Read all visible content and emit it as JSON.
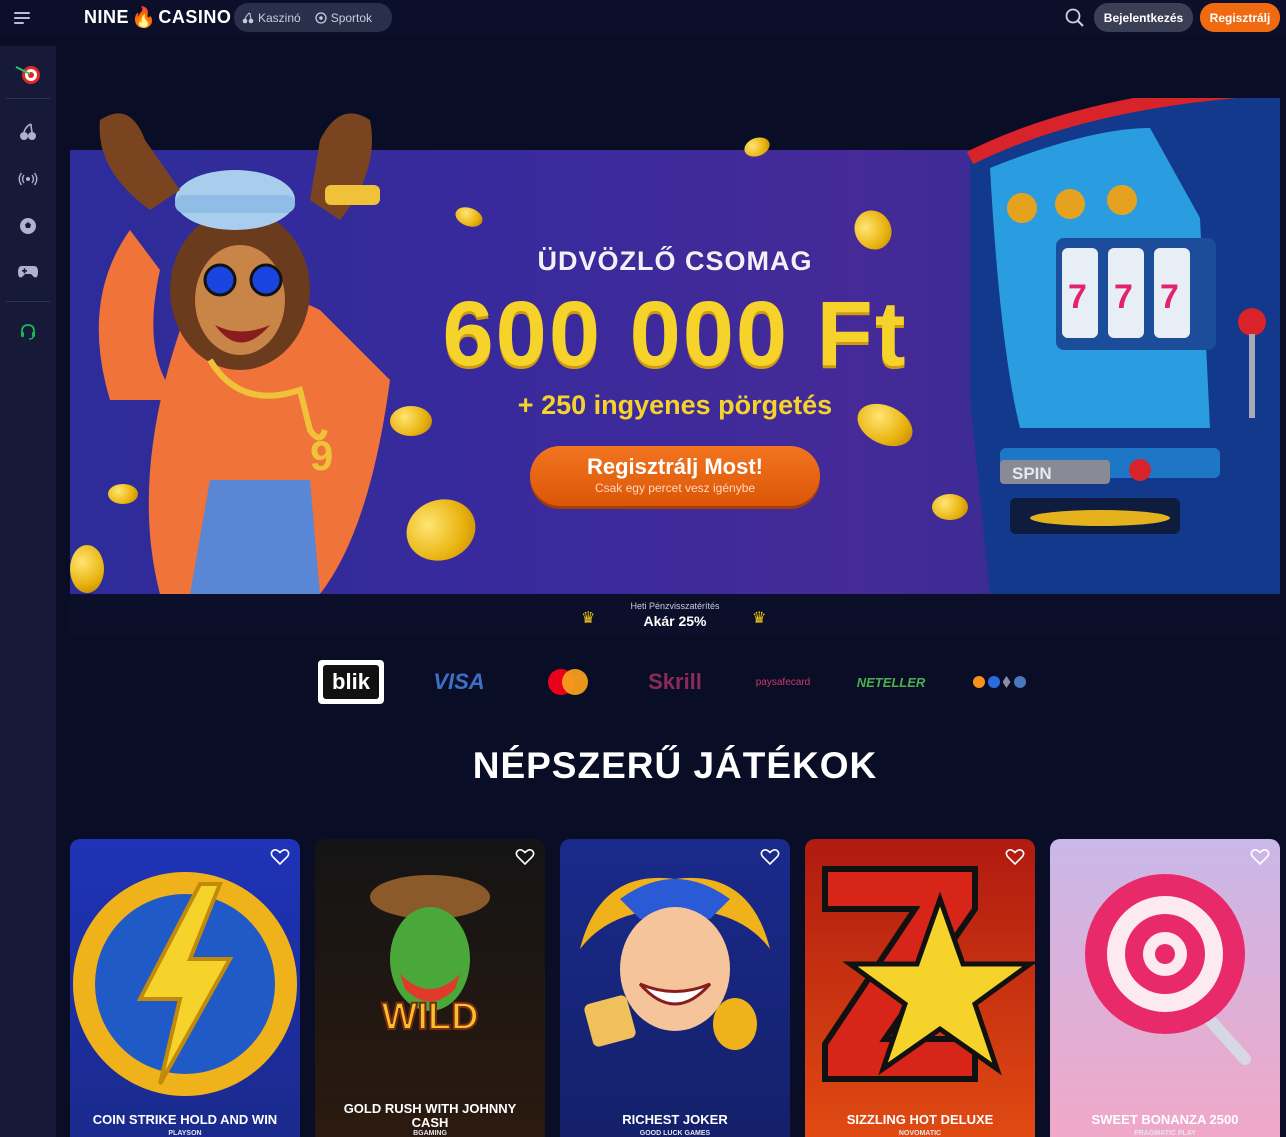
{
  "header": {
    "logo_left": "NINE",
    "logo_right": "CASINO",
    "nav": [
      {
        "label": "Kaszinó",
        "icon": "cherry-icon"
      },
      {
        "label": "Sportok",
        "icon": "soccer-ball-icon"
      }
    ],
    "login_label": "Bejelentkezés",
    "register_label": "Regisztrálj"
  },
  "sidebar": {
    "items": [
      {
        "name": "darts-target-icon"
      },
      {
        "name": "cherry-icon"
      },
      {
        "name": "live-broadcast-icon"
      },
      {
        "name": "soccer-ball-icon"
      },
      {
        "name": "gamepad-icon"
      },
      {
        "name": "support-headset-icon"
      }
    ]
  },
  "hero": {
    "title": "ÜDVÖZLŐ CSOMAG",
    "amount": "600 000 Ft",
    "subtitle": "+ 250 ingyenes pörgetés",
    "cta_label": "Regisztrálj Most!",
    "cta_sub": "Csak egy percet vesz igénybe",
    "slot_button": "SPIN"
  },
  "cashback": {
    "label": "Heti Pénzvisszatérítés",
    "value": "Akár 25%"
  },
  "payments": [
    "blik",
    "VISA",
    "Mastercard",
    "Skrill",
    "paysafecard",
    "NETELLER",
    "Crypto"
  ],
  "popular": {
    "title": "NÉPSZERŰ JÁTÉKOK",
    "games": [
      {
        "name": "COIN STRIKE HOLD AND WIN",
        "provider": "PLAYSON"
      },
      {
        "name": "GOLD RUSH WITH JOHNNY CASH",
        "provider": "BGAMING",
        "art_text": "WILD"
      },
      {
        "name": "RICHEST JOKER",
        "provider": "GOOD LUCK GAMES"
      },
      {
        "name": "SIZZLING HOT DELUXE",
        "provider": "NOVOMATIC"
      },
      {
        "name": "SWEET BONANZA 2500",
        "provider": "PRAGMATIC PLAY"
      }
    ]
  },
  "colors": {
    "accent": "#ef6a10",
    "gold": "#f6d32b",
    "bg": "#0a0d26",
    "sidebar": "#161a38"
  }
}
